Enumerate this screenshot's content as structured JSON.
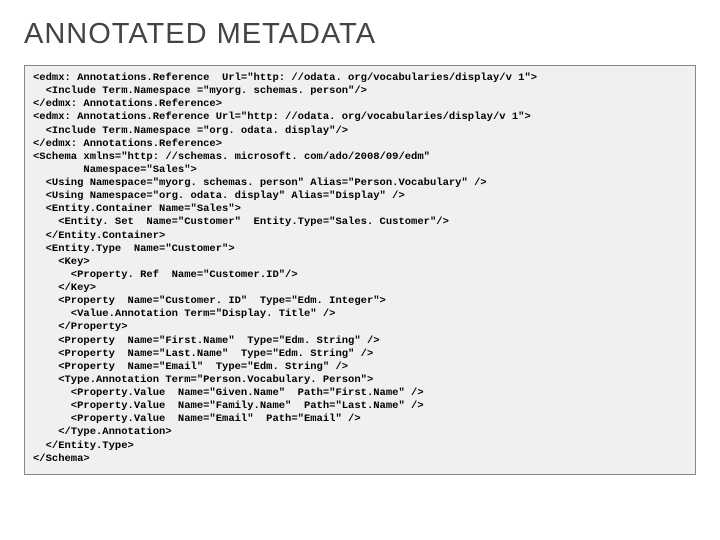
{
  "title": "ANNOTATED METADATA",
  "code": "<edmx: Annotations.Reference  Url=\"http: //odata. org/vocabularies/display/v 1\">\n  <Include Term.Namespace =\"myorg. schemas. person\"/>\n</edmx: Annotations.Reference>\n<edmx: Annotations.Reference Url=\"http: //odata. org/vocabularies/display/v 1\">\n  <Include Term.Namespace =\"org. odata. display\"/>\n</edmx: Annotations.Reference>\n<Schema xmlns=\"http: //schemas. microsoft. com/ado/2008/09/edm\"\n        Namespace=\"Sales\">\n  <Using Namespace=\"myorg. schemas. person\" Alias=\"Person.Vocabulary\" />\n  <Using Namespace=\"org. odata. display\" Alias=\"Display\" />\n  <Entity.Container Name=\"Sales\">\n    <Entity. Set  Name=\"Customer\"  Entity.Type=\"Sales. Customer\"/>\n  </Entity.Container>\n  <Entity.Type  Name=\"Customer\">\n    <Key>\n      <Property. Ref  Name=\"Customer.ID\"/>\n    </Key>\n    <Property  Name=\"Customer. ID\"  Type=\"Edm. Integer\">\n      <Value.Annotation Term=\"Display. Title\" />\n    </Property>\n    <Property  Name=\"First.Name\"  Type=\"Edm. String\" />\n    <Property  Name=\"Last.Name\"  Type=\"Edm. String\" />\n    <Property  Name=\"Email\"  Type=\"Edm. String\" />\n    <Type.Annotation Term=\"Person.Vocabulary. Person\">\n      <Property.Value  Name=\"Given.Name\"  Path=\"First.Name\" />\n      <Property.Value  Name=\"Family.Name\"  Path=\"Last.Name\" />\n      <Property.Value  Name=\"Email\"  Path=\"Email\" />\n    </Type.Annotation>\n  </Entity.Type>\n</Schema>"
}
